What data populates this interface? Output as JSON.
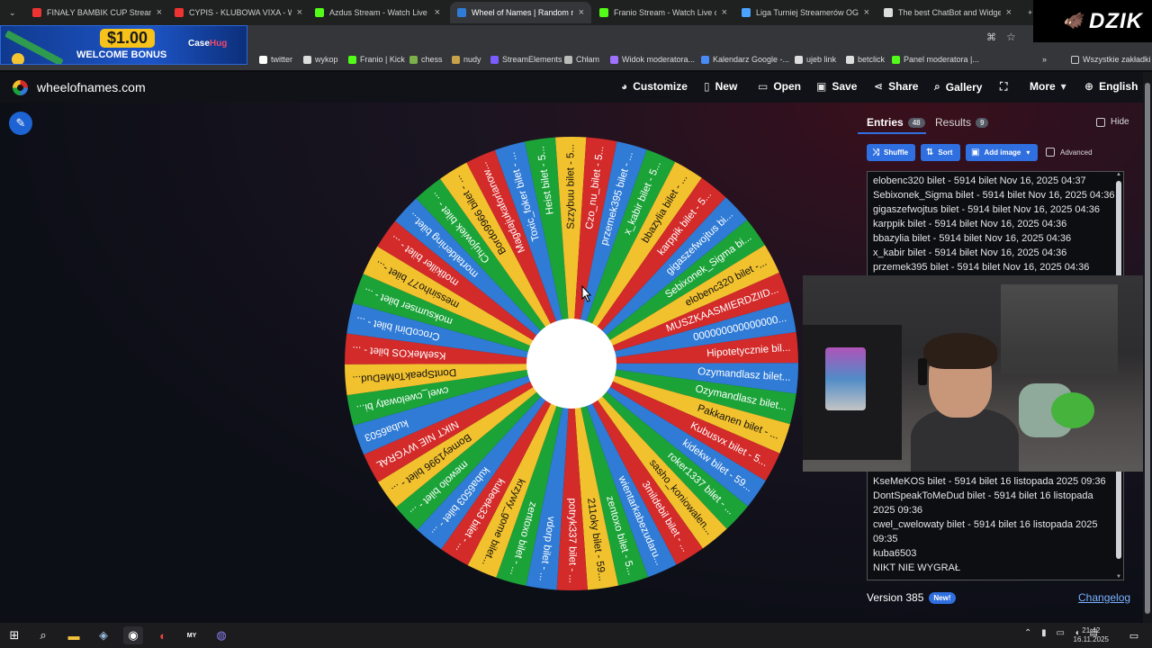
{
  "browser": {
    "tabs": [
      {
        "title": "FINAŁY BAMBIK CUP Stream",
        "fav": "#e33",
        "active": false
      },
      {
        "title": "CYPIS - KLUBOWA VIXA - W",
        "fav": "#e33",
        "active": false
      },
      {
        "title": "Azdus Stream - Watch Live on",
        "fav": "#53fc18",
        "active": false
      },
      {
        "title": "Wheel of Names | Random nam",
        "fav": "#2f7bd6",
        "active": true
      },
      {
        "title": "Franio Stream - Watch Live on",
        "fav": "#53fc18",
        "active": false
      },
      {
        "title": "Liga Turniej Streamerów OG D",
        "fav": "#4aa3ff",
        "active": false
      },
      {
        "title": "The best ChatBot and Widgets",
        "fav": "#ddd",
        "active": false
      }
    ],
    "bookmarks": [
      {
        "label": "twitter"
      },
      {
        "label": "wykop"
      },
      {
        "label": "Franio | Kick"
      },
      {
        "label": "chess"
      },
      {
        "label": "nudy"
      },
      {
        "label": "StreamElements"
      },
      {
        "label": "Chłam"
      },
      {
        "label": "Widok moderatora..."
      },
      {
        "label": "Kalendarz Google -..."
      },
      {
        "label": "ujeb link"
      },
      {
        "label": "betclick"
      },
      {
        "label": "Panel moderatora |..."
      }
    ],
    "all_bookmarks": "Wszystkie zakładki"
  },
  "ad": {
    "price": "$1.00",
    "welcome": "WELCOME BONUS",
    "brand_a": "Case",
    "brand_b": "Hug"
  },
  "overlay_logo": "DZIK",
  "app": {
    "site": "wheelofnames.com",
    "menu": [
      {
        "label": "Customize",
        "icon": "palette-icon"
      },
      {
        "label": "New",
        "icon": "file-icon"
      },
      {
        "label": "Open",
        "icon": "folder-icon"
      },
      {
        "label": "Save",
        "icon": "save-icon"
      },
      {
        "label": "Share",
        "icon": "share-icon"
      },
      {
        "label": "Gallery",
        "icon": "search-icon"
      },
      {
        "label": "",
        "icon": "fullscreen-icon"
      },
      {
        "label": "More",
        "icon": "chevron-down-icon"
      },
      {
        "label": "English",
        "icon": "globe-icon"
      }
    ]
  },
  "wheel": {
    "colors": [
      "#d32a2a",
      "#2f7bd6",
      "#1ba338",
      "#f2c12e"
    ],
    "labels": [
      "Hipotetycznie bil...",
      "Ozymandlasz bilet...",
      "Ozymandlasz bilet...",
      "Pakkanen bilet - ...",
      "Kubusvx bilet - 5...",
      "kidekw bilet - 59...",
      "roker1337 bilet - ...",
      "sasho_koniowalen...",
      "3mildebil bilet - ...",
      "wientarkabezudaru...",
      "zentoxo bilet - 5...",
      "211oky bilet - 59...",
      "potryk337 bilet - ...",
      "vdorp bilet - ...",
      "zentoxo bilet - ...",
      "krzywy_gome bilet...",
      "kubeek33 bilet - ...",
      "kuba6503 bilet - ...",
      "mewolo bilet - ...",
      "Bomey1996 bilet - ...",
      "NIKT NIE WYGRAŁ",
      "kuba6503",
      "cwel_cwelowaty bi...",
      "DontSpeakToMeDud...",
      "KseMeKOS bilet - ...",
      "CrocoDini bilet - ...",
      "moksumser bilet - ...",
      "messinho77 bilet -...",
      "motikiller bilet - ...",
      "mortaldening bilet...",
      "Chujowiek bilet - ...",
      "Bordo9966 bilet - ...",
      "Magdajukaforlanow...",
      "Toxic_foker bilet - ...",
      "Heist bilet - 5...",
      "Szzybuu bilet - 5...",
      "Czo_nu_bilet - 5...",
      "przemek395 bilet - ...",
      "x_kabir bilet - 5...",
      "bbazylia bilet - ...",
      "karppik bilet - 5...",
      "gigaszefwojtus bi...",
      "Sebixonek_Sigma bi...",
      "elobenc320 bilet -...",
      "MUSZKAASMIERDZIID...",
      "000000000000000..."
    ]
  },
  "panel": {
    "tab_entries": "Entries",
    "entries_count": "48",
    "tab_results": "Results",
    "results_count": "9",
    "hide_label": "Hide",
    "shuffle": "Shuffle",
    "sort": "Sort",
    "add_image": "Add image",
    "advanced": "Advanced",
    "entries_top": [
      "elobenc320 bilet - 5914 bilet Nov 16, 2025 04:37",
      "Sebixonek_Sigma bilet - 5914 bilet Nov 16, 2025 04:36",
      "gigaszefwojtus bilet - 5914 bilet Nov 16, 2025 04:36",
      "karppik bilet - 5914 bilet Nov 16, 2025 04:36",
      "bbazylia bilet - 5914 bilet Nov 16, 2025 04:36",
      "x_kabir bilet - 5914 bilet Nov 16, 2025 04:36",
      "przemek395 bilet - 5914 bilet Nov 16, 2025 04:36"
    ],
    "entries_bottom": [
      "KseMeKOS bilet - 5914 bilet 16 listopada 2025 09:36",
      "DontSpeakToMeDud bilet - 5914 bilet 16 listopada 2025 09:36",
      "cwel_cwelowaty bilet - 5914 bilet 16 listopada 2025 09:35",
      "kuba6503",
      "NIKT NIE WYGRAŁ"
    ],
    "version": "Version 385",
    "new_badge": "New!",
    "changelog": "Changelog"
  },
  "taskbar": {
    "time": "21:42",
    "date": "16.11.2025"
  }
}
